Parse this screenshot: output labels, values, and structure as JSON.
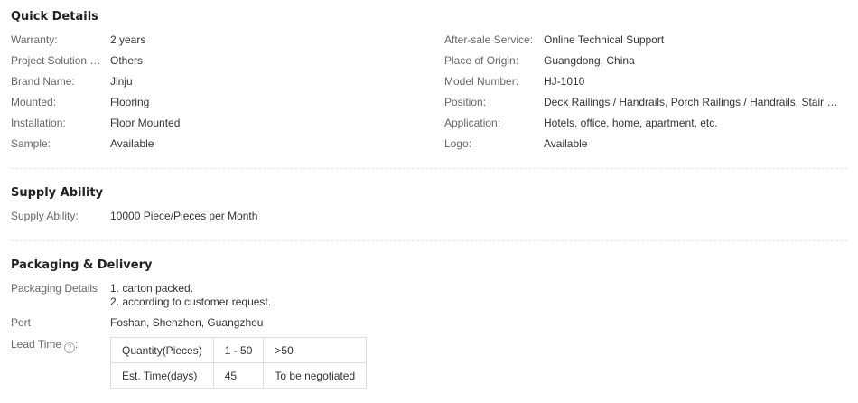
{
  "quick_details": {
    "title": "Quick Details",
    "left": [
      {
        "label": "Warranty:",
        "value": "2 years"
      },
      {
        "label": "Project Solution Capability:",
        "value": "Others"
      },
      {
        "label": "Brand Name:",
        "value": "Jinju"
      },
      {
        "label": "Mounted:",
        "value": "Flooring"
      },
      {
        "label": "Installation:",
        "value": "Floor Mounted"
      },
      {
        "label": "Sample:",
        "value": "Available"
      }
    ],
    "right": [
      {
        "label": "After-sale Service:",
        "value": "Online Technical Support"
      },
      {
        "label": "Place of Origin:",
        "value": "Guangdong, China"
      },
      {
        "label": "Model Number:",
        "value": "HJ-1010"
      },
      {
        "label": "Position:",
        "value": "Deck Railings / Handrails, Porch Railings / Handrails, Stair Railings / Handrails"
      },
      {
        "label": "Application:",
        "value": "Hotels, office, home, apartment, etc."
      },
      {
        "label": "Logo:",
        "value": "Available"
      }
    ]
  },
  "supply_ability": {
    "title": "Supply Ability",
    "label": "Supply Ability:",
    "value": "10000 Piece/Pieces per Month"
  },
  "packaging": {
    "title": "Packaging & Delivery",
    "details_label": "Packaging Details",
    "details_lines": [
      "1. carton packed.",
      "2. according to customer request."
    ],
    "port_label": "Port",
    "port_value": "Foshan, Shenzhen, Guangzhou",
    "lead_time_label": "Lead Time",
    "help_icon": "question-circle-icon",
    "lead_table": {
      "row1": [
        "Quantity(Pieces)",
        "1 - 50",
        ">50"
      ],
      "row2": [
        "Est. Time(days)",
        "45",
        "To be negotiated"
      ]
    }
  }
}
